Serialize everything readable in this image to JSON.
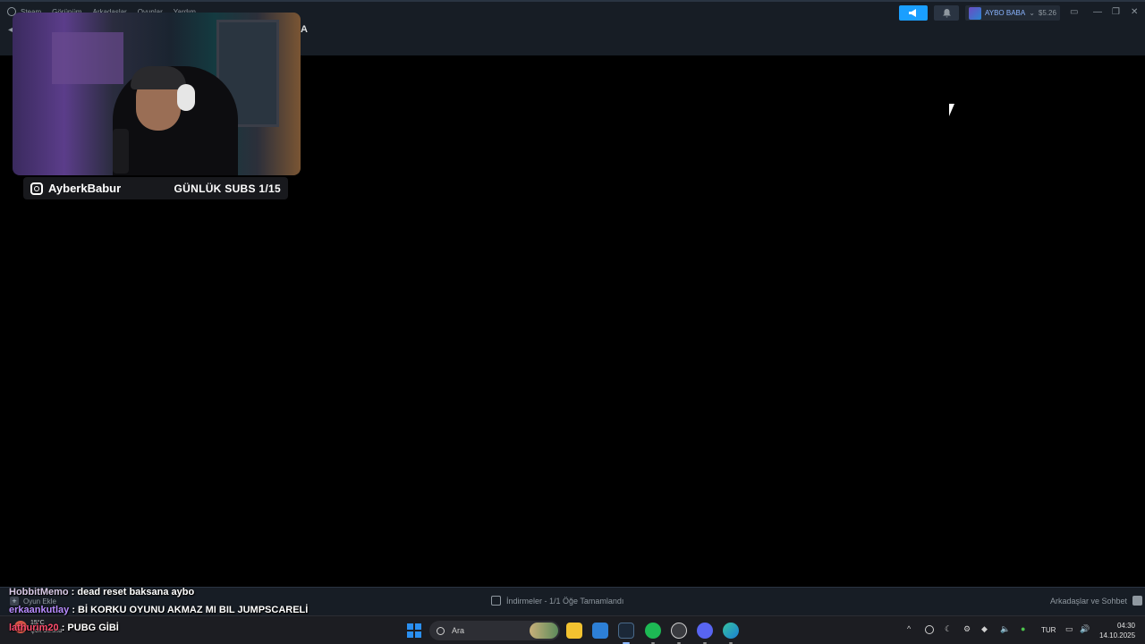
{
  "steam": {
    "menu": [
      "Steam",
      "Görünüm",
      "Arkadaşlar",
      "Oyunlar",
      "Yardım"
    ],
    "page_title_fragment": "A",
    "user_name": "AYBO BABA",
    "wallet": "$5.26",
    "add_game": "Oyun Ekle",
    "downloads": "İndirmeler - 1/1 Öğe Tamamlandı",
    "friends_chat": "Arkadaşlar ve Sohbet"
  },
  "stream": {
    "handle": "AyberkBabur",
    "subs_goal": "GÜNLÜK SUBS 1/15"
  },
  "chat": [
    {
      "user": "HobbitMemo",
      "message": " : dead reset baksana aybo"
    },
    {
      "user": "erkaankutlay",
      "message": " : Bİ KORKU OYUNU AKMAZ MI BIL JUMPSCARELİ"
    },
    {
      "user": "lathurim20",
      "message": " : PUBG GİBİ"
    }
  ],
  "taskbar": {
    "weather_temp": "15°C",
    "weather_desc": "Çok bulutlu",
    "search_placeholder": "Ara",
    "language": "TUR",
    "time": "04:30",
    "date": "14.10.2025"
  },
  "colors": {
    "steam_bg": "#171d25",
    "accent_blue": "#1a9fff",
    "windows_blue": "#2a8ff0"
  }
}
